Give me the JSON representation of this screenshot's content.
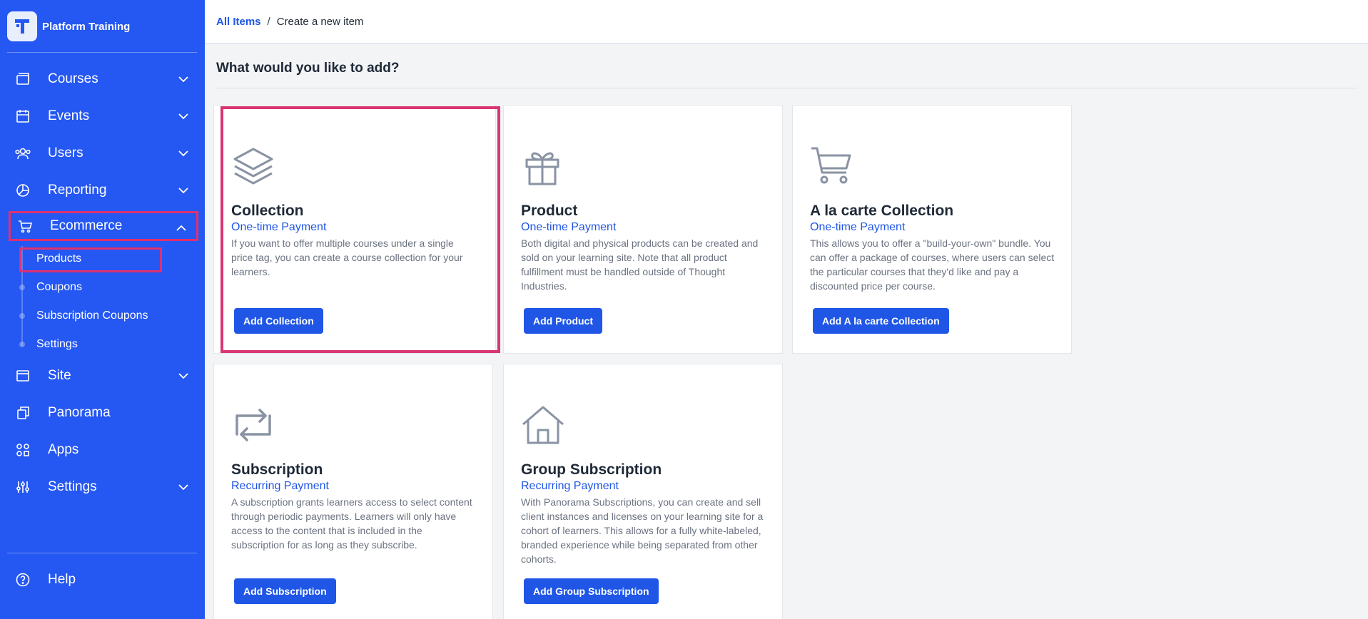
{
  "brand": {
    "name": "Platform Training"
  },
  "sidebar": {
    "items": [
      {
        "label": "Courses",
        "icon": "courses-icon"
      },
      {
        "label": "Events",
        "icon": "calendar-icon"
      },
      {
        "label": "Users",
        "icon": "users-icon"
      },
      {
        "label": "Reporting",
        "icon": "pie-chart-icon"
      },
      {
        "label": "Ecommerce",
        "icon": "cart-icon"
      },
      {
        "label": "Site",
        "icon": "browser-icon"
      },
      {
        "label": "Panorama",
        "icon": "copy-icon"
      },
      {
        "label": "Apps",
        "icon": "apps-icon"
      },
      {
        "label": "Settings",
        "icon": "sliders-icon"
      }
    ],
    "ecommerce_sub": [
      "Products",
      "Coupons",
      "Subscription Coupons",
      "Settings"
    ],
    "help_label": "Help"
  },
  "breadcrumb": {
    "link": "All Items",
    "separator": "/",
    "current": "Create a new item"
  },
  "heading": "What would you like to add?",
  "cards": [
    {
      "title": "Collection",
      "subtitle": "One-time Payment",
      "description": "If you want to offer multiple courses under a single price tag, you can create a course collection for your learners.",
      "button": "Add Collection",
      "icon": "layers-icon"
    },
    {
      "title": "Product",
      "subtitle": "One-time Payment",
      "description": "Both digital and physical products can be created and sold on your learning site. Note that all product fulfillment must be handled outside of Thought Industries.",
      "button": "Add Product",
      "icon": "gift-icon"
    },
    {
      "title": "A la carte Collection",
      "subtitle": "One-time Payment",
      "description": "This allows you to offer a \"build-your-own\" bundle. You can offer a package of courses, where users can select the particular courses that they'd like and pay a discounted price per course.",
      "button": "Add A la carte Collection",
      "icon": "shopping-cart-icon"
    },
    {
      "title": "Subscription",
      "subtitle": "Recurring Payment",
      "description": "A subscription grants learners access to select content through periodic payments. Learners will only have access to the content that is included in the subscription for as long as they subscribe.",
      "button": "Add Subscription",
      "icon": "repeat-icon"
    },
    {
      "title": "Group Subscription",
      "subtitle": "Recurring Payment",
      "description": "With Panorama Subscriptions, you can create and sell client instances and licenses on your learning site for a cohort of learners. This allows for a fully white-labeled, branded experience while being separated from other cohorts.",
      "button": "Add Group Subscription",
      "icon": "home-icon"
    }
  ],
  "colors": {
    "sidebar": "#2557f2",
    "accent": "#1f56e6",
    "highlight": "#e0316f"
  }
}
